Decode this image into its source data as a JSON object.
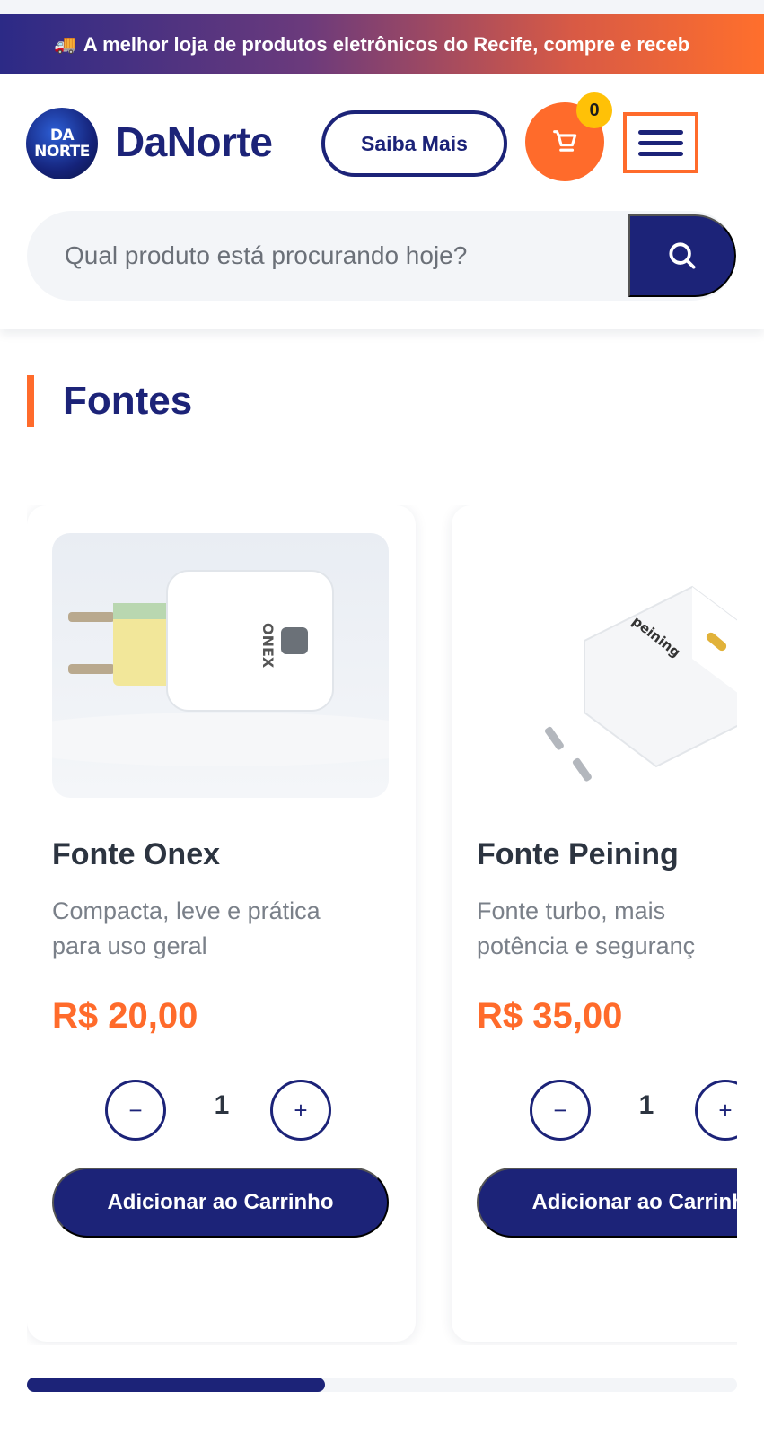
{
  "announcement": {
    "icon": "truck-icon",
    "text": "A melhor loja de produtos eletrônicos do Recife, compre e receb"
  },
  "header": {
    "logo_line1": "DA",
    "logo_line2": "NORTE",
    "brand": "DaNorte",
    "saiba_label": "Saiba Mais",
    "cart_count": "0",
    "search_placeholder": "Qual produto está procurando hoje?"
  },
  "section": {
    "title": "Fontes"
  },
  "products": [
    {
      "name": "Fonte Onex",
      "description_line1": "Compacta, leve e prática",
      "description_line2": "para uso geral",
      "price": "R$ 20,00",
      "quantity": "1",
      "minus": "−",
      "plus": "+",
      "add_label": "Adicionar ao Carrinho",
      "image_brand": "ONEX"
    },
    {
      "name": "Fonte Peining",
      "description_line1": "Fonte turbo, mais",
      "description_line2": "potência e seguranç",
      "price": "R$ 35,00",
      "quantity": "1",
      "minus": "−",
      "plus": "+",
      "add_label": "Adicionar ao Carrinho",
      "image_brand": "peining"
    }
  ],
  "carousel": {
    "scroll_progress": 0.42
  },
  "colors": {
    "primary": "#1c2378",
    "accent": "#ff6b2b",
    "badge": "#ffc107"
  }
}
